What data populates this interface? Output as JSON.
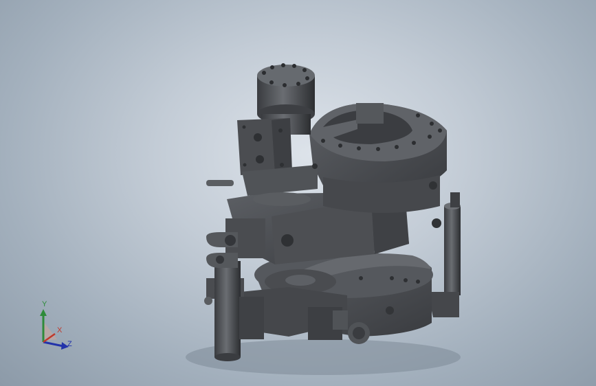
{
  "viewport": {
    "background_colors": [
      "#dde3ea",
      "#8c9aa8"
    ],
    "model_color": "#4e5054"
  },
  "triad": {
    "x_label": "X",
    "y_label": "Y",
    "z_label": "Z",
    "x_color": "#c0392b",
    "y_color": "#2e8b3a",
    "z_color": "#2233aa"
  }
}
